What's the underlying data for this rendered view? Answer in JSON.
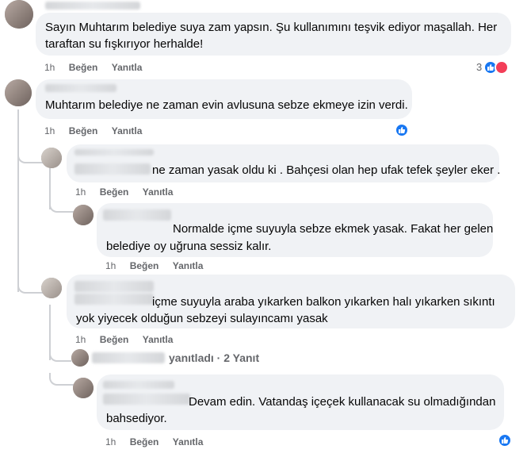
{
  "comments": [
    {
      "text_lines": [
        "Sayın Muhtarım belediye suya zam yapsın. Şu kullanımını teşvik ediyor maşallah. Her",
        "taraftan su fışkırıyor herhalde!"
      ],
      "time": "1h",
      "like_label": "Beğen",
      "reply_label": "Yanıtla",
      "reaction_count": "3"
    },
    {
      "text_lines": [
        "Muhtarım belediye ne zaman evin avlusuna sebze ekmeye izin verdi."
      ],
      "time": "1h",
      "like_label": "Beğen",
      "reply_label": "Yanıtla"
    },
    {
      "text_lines": [
        "ne zaman yasak oldu ki . Bahçesi olan hep ufak tefek şeyler eker ."
      ],
      "time": "1h",
      "like_label": "Beğen",
      "reply_label": "Yanıtla"
    },
    {
      "text_lines": [
        "Normalde içme suyuyla sebze ekmek yasak. Fakat her gelen",
        "belediye oy uğruna sessiz kalır."
      ],
      "time": "1h",
      "like_label": "Beğen",
      "reply_label": "Yanıtla"
    },
    {
      "text_lines": [
        "içme suyuyla araba yıkarken balkon yıkarken halı yıkarken sıkıntı",
        "yok yiyecek olduğun sebzeyi sulayıncamı yasak"
      ],
      "time": "1h",
      "like_label": "Beğen",
      "reply_label": "Yanıtla",
      "replies_summary": "yanıtladı · 2 Yanıt"
    },
    {
      "text_lines": [
        "Devam edin. Vatandaş içeçek kullanacak su olmadığından",
        "bahsediyor."
      ],
      "time": "1h",
      "like_label": "Beğen",
      "reply_label": "Yanıtla"
    }
  ],
  "colors": {
    "bubble": "#f0f2f5",
    "meta": "#65676b",
    "like": "#1877f2",
    "love": "#f33e58"
  },
  "icons": [
    "like-reaction-icon",
    "love-reaction-icon"
  ]
}
